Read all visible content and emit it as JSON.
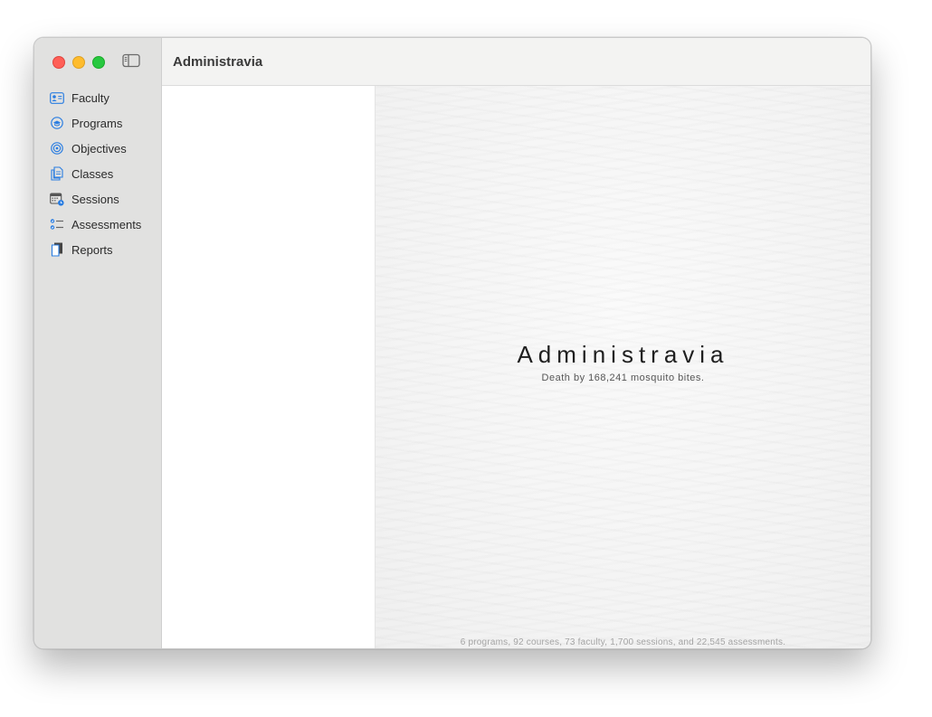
{
  "window": {
    "title": "Administravia"
  },
  "sidebar": {
    "items": [
      {
        "label": "Faculty",
        "icon": "person-card-icon"
      },
      {
        "label": "Programs",
        "icon": "graduation-cap-icon"
      },
      {
        "label": "Objectives",
        "icon": "target-icon"
      },
      {
        "label": "Classes",
        "icon": "documents-icon"
      },
      {
        "label": "Sessions",
        "icon": "calendar-badge-icon"
      },
      {
        "label": "Assessments",
        "icon": "checklist-icon"
      },
      {
        "label": "Reports",
        "icon": "report-icon"
      }
    ]
  },
  "detail": {
    "heading": "Administravia",
    "subtitle": "Death by 168,241 mosquito bites.",
    "stats": "6 programs, 92 courses, 73 faculty, 1,700 sessions, and 22,545 assessments."
  },
  "colors": {
    "accent": "#2a7de1",
    "sidebar_bg": "#e1e1e0"
  }
}
